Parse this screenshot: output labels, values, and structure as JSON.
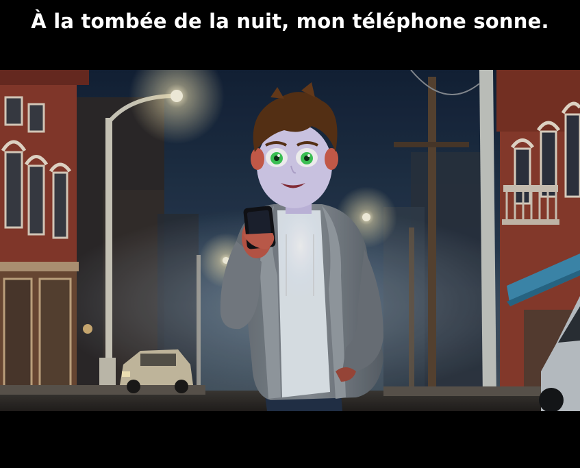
{
  "caption": {
    "text": "À la tombée de la nuit, mon téléphone sonne."
  },
  "scene": {
    "palette": {
      "sky": "#16263a",
      "fog": "#8aa0b3",
      "brick": "#8e3b2c",
      "hoodie": "#7d848a",
      "shirt": "#e6eef4",
      "jeans": "#23324a",
      "hair": "#5b3316",
      "eyes": "#3fcf5a",
      "lamp_glow": "#fff3c9",
      "awning": "#3f8fb5"
    },
    "icons": [
      "street-lamp-icon",
      "smartphone-icon",
      "car-icon",
      "utility-pole-icon"
    ]
  }
}
